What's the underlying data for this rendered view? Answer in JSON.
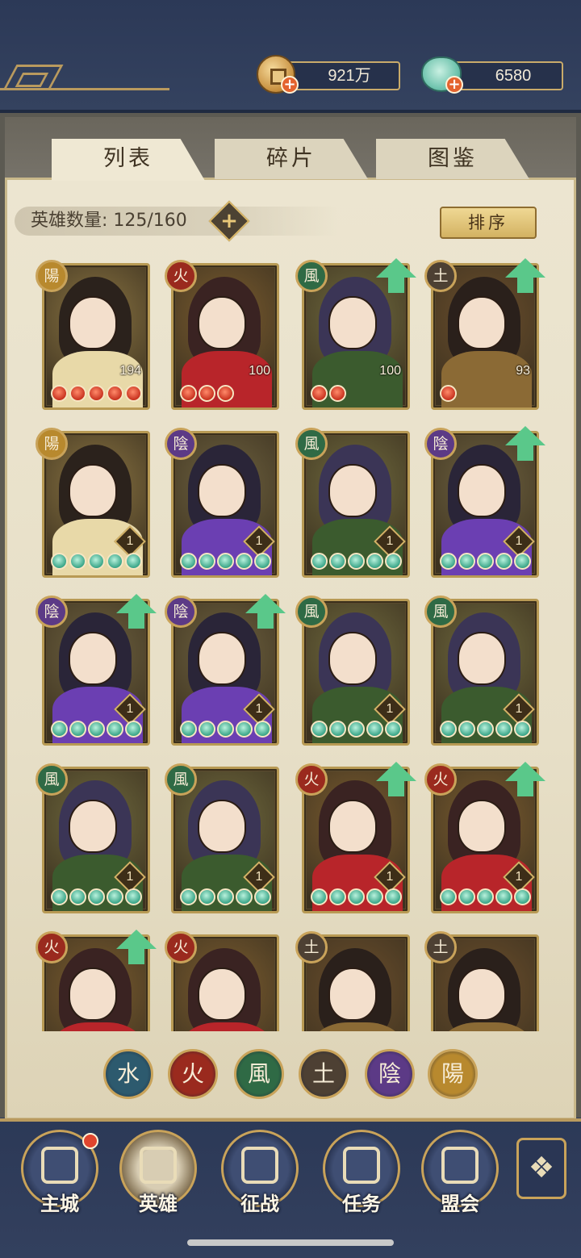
{
  "currencies": {
    "coins": "921万",
    "jade": "6580"
  },
  "tabs": [
    {
      "label": "列表",
      "active": true
    },
    {
      "label": "碎片",
      "active": false
    },
    {
      "label": "图鉴",
      "active": false
    }
  ],
  "hero_count": {
    "label": "英雄数量: 125/160"
  },
  "sort_button": "排序",
  "elements": {
    "yang": {
      "glyph": "陽",
      "color": "#b8892e"
    },
    "fire": {
      "glyph": "火",
      "color": "#9a2a1e"
    },
    "wind": {
      "glyph": "風",
      "color": "#2f6a45"
    },
    "earth": {
      "glyph": "土",
      "color": "#4d4033"
    },
    "yin": {
      "glyph": "陰",
      "color": "#5c3a86"
    },
    "water": {
      "glyph": "水",
      "color": "#2d5a6e"
    }
  },
  "heroes": [
    {
      "element": "yang",
      "badge": "陽",
      "level": "194",
      "pips": 5,
      "pip_type": "red",
      "upgrade": false
    },
    {
      "element": "fire",
      "badge": "火",
      "level": "100",
      "pips": 3,
      "pip_type": "red",
      "upgrade": false
    },
    {
      "element": "wind",
      "badge": "風",
      "level": "100",
      "pips": 2,
      "pip_type": "red",
      "upgrade": true
    },
    {
      "element": "earth",
      "badge": "土",
      "level": "93",
      "pips": 1,
      "pip_type": "red",
      "upgrade": true
    },
    {
      "element": "yang",
      "badge": "陽",
      "level": "1",
      "pips": 5,
      "pip_type": "jade",
      "upgrade": false
    },
    {
      "element": "yin",
      "badge": "陰",
      "level": "1",
      "pips": 5,
      "pip_type": "jade",
      "upgrade": false
    },
    {
      "element": "wind",
      "badge": "風",
      "level": "1",
      "pips": 5,
      "pip_type": "jade",
      "upgrade": false
    },
    {
      "element": "yin",
      "badge": "陰",
      "level": "1",
      "pips": 5,
      "pip_type": "jade",
      "upgrade": true
    },
    {
      "element": "yin",
      "badge": "陰",
      "level": "1",
      "pips": 5,
      "pip_type": "jade",
      "upgrade": true
    },
    {
      "element": "yin",
      "badge": "陰",
      "level": "1",
      "pips": 5,
      "pip_type": "jade",
      "upgrade": true
    },
    {
      "element": "wind",
      "badge": "風",
      "level": "1",
      "pips": 5,
      "pip_type": "jade",
      "upgrade": false
    },
    {
      "element": "wind",
      "badge": "風",
      "level": "1",
      "pips": 5,
      "pip_type": "jade",
      "upgrade": false
    },
    {
      "element": "wind",
      "badge": "風",
      "level": "1",
      "pips": 5,
      "pip_type": "jade",
      "upgrade": false
    },
    {
      "element": "wind",
      "badge": "風",
      "level": "1",
      "pips": 5,
      "pip_type": "jade",
      "upgrade": false
    },
    {
      "element": "fire",
      "badge": "火",
      "level": "1",
      "pips": 5,
      "pip_type": "jade",
      "upgrade": true
    },
    {
      "element": "fire",
      "badge": "火",
      "level": "1",
      "pips": 5,
      "pip_type": "jade",
      "upgrade": true
    },
    {
      "element": "fire",
      "badge": "火",
      "level": "",
      "pips": 0,
      "pip_type": "jade",
      "upgrade": true
    },
    {
      "element": "fire",
      "badge": "火",
      "level": "",
      "pips": 0,
      "pip_type": "jade",
      "upgrade": false
    },
    {
      "element": "earth",
      "badge": "土",
      "level": "",
      "pips": 0,
      "pip_type": "jade",
      "upgrade": false
    },
    {
      "element": "earth",
      "badge": "土",
      "level": "",
      "pips": 0,
      "pip_type": "jade",
      "upgrade": false
    }
  ],
  "filters": [
    {
      "element": "water",
      "glyph": "水"
    },
    {
      "element": "fire",
      "glyph": "火"
    },
    {
      "element": "wind",
      "glyph": "風"
    },
    {
      "element": "earth",
      "glyph": "土"
    },
    {
      "element": "yin",
      "glyph": "陰"
    },
    {
      "element": "yang",
      "glyph": "陽"
    }
  ],
  "nav": [
    {
      "label": "主城",
      "icon": "city-gate-icon",
      "notification": true
    },
    {
      "label": "英雄",
      "icon": "hero-portrait-icon",
      "notification": false
    },
    {
      "label": "征战",
      "icon": "battle-scroll-icon",
      "notification": false
    },
    {
      "label": "任务",
      "icon": "quest-flag-icon",
      "notification": false
    },
    {
      "label": "盟会",
      "icon": "guild-pavilion-icon",
      "notification": false
    }
  ],
  "hero_palettes": {
    "yang": {
      "bg": "#8a7442",
      "hair": "#2b221c",
      "robe": "#e8d9a8"
    },
    "fire": {
      "bg": "#7b5c2f",
      "hair": "#3a2322",
      "robe": "#b8252a"
    },
    "wind": {
      "bg": "#6f6a3e",
      "hair": "#3b3556",
      "robe": "#3b5b2e"
    },
    "earth": {
      "bg": "#6b4e2c",
      "hair": "#2a201b",
      "robe": "#8b6a35"
    },
    "yin": {
      "bg": "#6e6240",
      "hair": "#2a2538",
      "robe": "#6b3fb2"
    }
  }
}
